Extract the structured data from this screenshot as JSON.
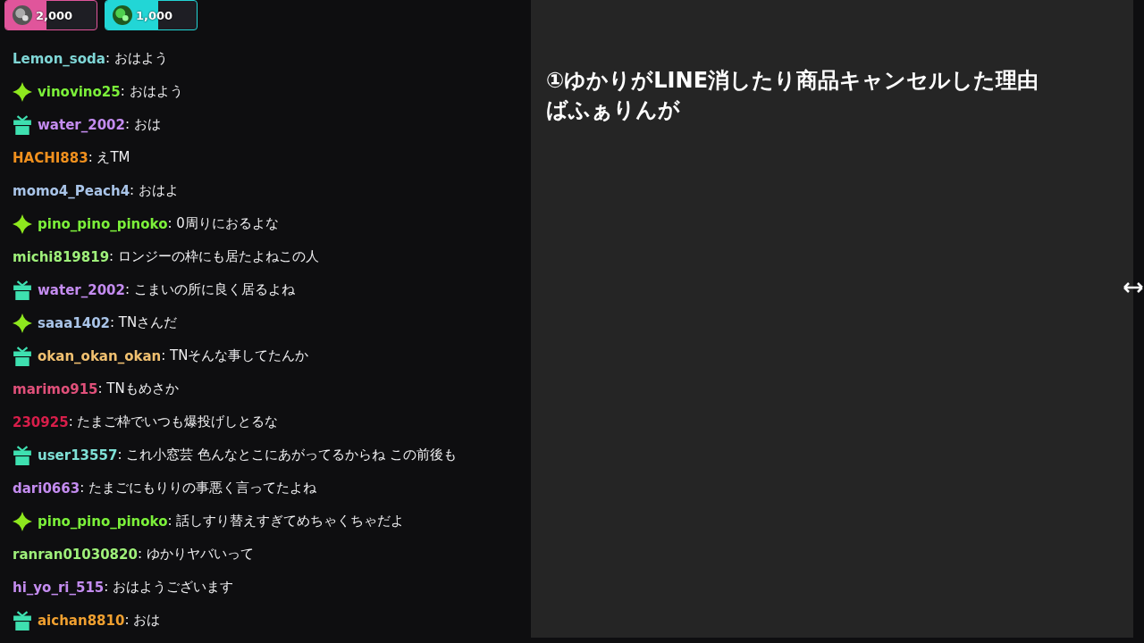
{
  "goals": [
    {
      "amount": "2,000",
      "level": 0.45,
      "color": "#e0559b"
    },
    {
      "amount": "1,000",
      "level": 0.58,
      "color": "#22d6d6"
    }
  ],
  "chat": [
    {
      "user": "Lemon_soda",
      "color": "#7fd6d6",
      "kind": "plain",
      "text": ": おはよう"
    },
    {
      "user": "vinovino25",
      "color": "#7cf03a",
      "kind": "sparkle",
      "text": ": おはよう"
    },
    {
      "user": "water_2002",
      "color": "#c48cf0",
      "kind": "gift",
      "text": ": おは"
    },
    {
      "user": "HACHI883",
      "color": "#f0901e",
      "kind": "plain",
      "text": ": えTM"
    },
    {
      "user": "momo4_Peach4",
      "color": "#a9c4e8",
      "kind": "plain",
      "text": ": おはよ"
    },
    {
      "user": "pino_pino_pinoko",
      "color": "#7cf03a",
      "kind": "sparkle",
      "text": ": 0周りにおるよな"
    },
    {
      "user": "michi819819",
      "color": "#9ff07a",
      "kind": "plain",
      "text": ": ロンジーの枠にも居たよねこの人"
    },
    {
      "user": "water_2002",
      "color": "#c48cf0",
      "kind": "gift",
      "text": ": こまいの所に良く居るよね"
    },
    {
      "user": "saaa1402",
      "color": "#a9c4e8",
      "kind": "sparkle",
      "text": ": TNさんだ"
    },
    {
      "user": "okan_okan_okan",
      "color": "#f0c070",
      "kind": "gift",
      "text": ": TNそんな事してたんか"
    },
    {
      "user": "marimo915",
      "color": "#e0507a",
      "kind": "plain",
      "text": ": TNもめさか"
    },
    {
      "user": "230925",
      "color": "#d81e4a",
      "kind": "plain",
      "text": ": たまご枠でいつも爆投げしとるな"
    },
    {
      "user": "user13557",
      "color": "#7fe0d6",
      "kind": "gift",
      "text": ": これ小窓芸 色んなとこにあがってるからね この前後も"
    },
    {
      "user": "dari0663",
      "color": "#c48cf0",
      "kind": "plain",
      "text": ": たまごにもりりの事悪く言ってたよね"
    },
    {
      "user": "pino_pino_pinoko",
      "color": "#7cf03a",
      "kind": "sparkle",
      "text": ": 話しすり替えすぎてめちゃくちゃだよ"
    },
    {
      "user": "ranran01030820",
      "color": "#9ff07a",
      "kind": "plain",
      "text": ": ゆかりヤバいって"
    },
    {
      "user": "hi_yo_ri_515",
      "color": "#c48cf0",
      "kind": "plain",
      "text": ": おはようございます"
    },
    {
      "user": "aichan8810",
      "color": "#f0a030",
      "kind": "gift",
      "text": ": おは"
    }
  ],
  "editor": {
    "lines": [
      "①ゆかりがLINE消したり商品キャンセルした理由",
      "ばふぁりんが"
    ]
  }
}
